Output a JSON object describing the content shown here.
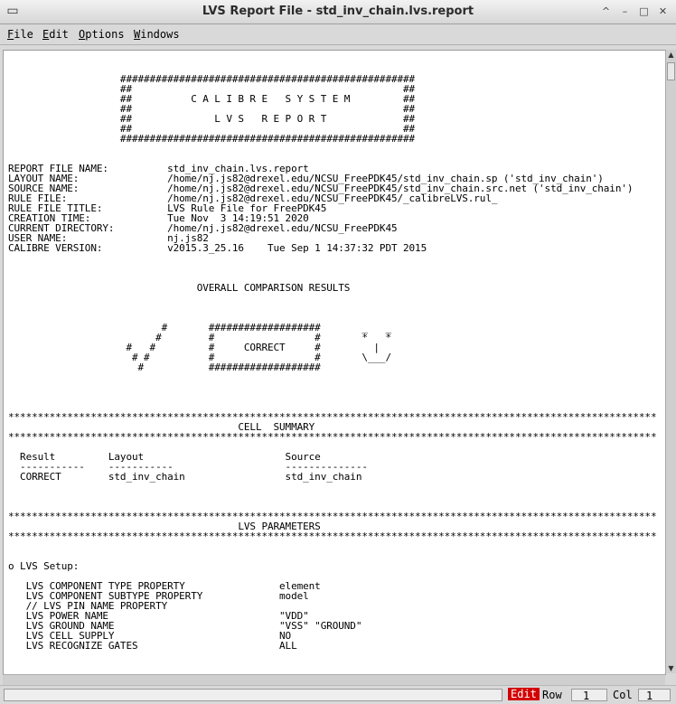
{
  "window": {
    "title": "LVS Report File - std_inv_chain.lvs.report",
    "app_icon": "terminal-window-icon",
    "buttons": [
      "restore-icon",
      "minimize-icon",
      "maximize-icon",
      "close-icon"
    ]
  },
  "menubar": {
    "file": "File",
    "edit": "Edit",
    "options": "Options",
    "windows": "Windows"
  },
  "report": {
    "text": "\n\n                   ##################################################\n                   ##                                              ##\n                   ##          C A L I B R E   S Y S T E M         ##\n                   ##                                              ##\n                   ##              L V S   R E P O R T             ##\n                   ##                                              ##\n                   ##################################################\n\n\nREPORT FILE NAME:          std_inv_chain.lvs.report\nLAYOUT NAME:               /home/nj.js82@drexel.edu/NCSU_FreePDK45/std_inv_chain.sp ('std_inv_chain')\nSOURCE NAME:               /home/nj.js82@drexel.edu/NCSU_FreePDK45/std_inv_chain.src.net ('std_inv_chain')\nRULE FILE:                 /home/nj.js82@drexel.edu/NCSU_FreePDK45/_calibreLVS.rul_\nRULE FILE TITLE:           LVS Rule File for FreePDK45\nCREATION TIME:             Tue Nov  3 14:19:51 2020\nCURRENT DIRECTORY:         /home/nj.js82@drexel.edu/NCSU_FreePDK45\nUSER NAME:                 nj.js82\nCALIBRE VERSION:           v2015.3_25.16    Tue Sep 1 14:37:32 PDT 2015\n\n\n\n                                OVERALL COMPARISON RESULTS\n\n\n\n                          #       ###################       _   _\n                         #        #                 #       *   *\n                    #   #         #     CORRECT     #         |\n                     # #          #                 #       \\___/\n                      #           ###################\n\n\n\n\n**************************************************************************************************************\n                                       CELL  SUMMARY\n**************************************************************************************************************\n\n  Result         Layout                        Source\n  -----------    -----------                   --------------\n  CORRECT        std_inv_chain                 std_inv_chain\n\n\n\n**************************************************************************************************************\n                                       LVS PARAMETERS\n**************************************************************************************************************\n\n\no LVS Setup:\n\n   LVS COMPONENT TYPE PROPERTY                element\n   LVS COMPONENT SUBTYPE PROPERTY             model\n   // LVS PIN NAME PROPERTY\n   LVS POWER NAME                             \"VDD\"\n   LVS GROUND NAME                            \"VSS\" \"GROUND\"\n   LVS CELL SUPPLY                            NO\n   LVS RECOGNIZE GATES                        ALL\n"
  },
  "statusbar": {
    "mode": "Edit",
    "row_label": "Row",
    "row_value": "1",
    "col_label": "Col",
    "col_value": "1"
  }
}
